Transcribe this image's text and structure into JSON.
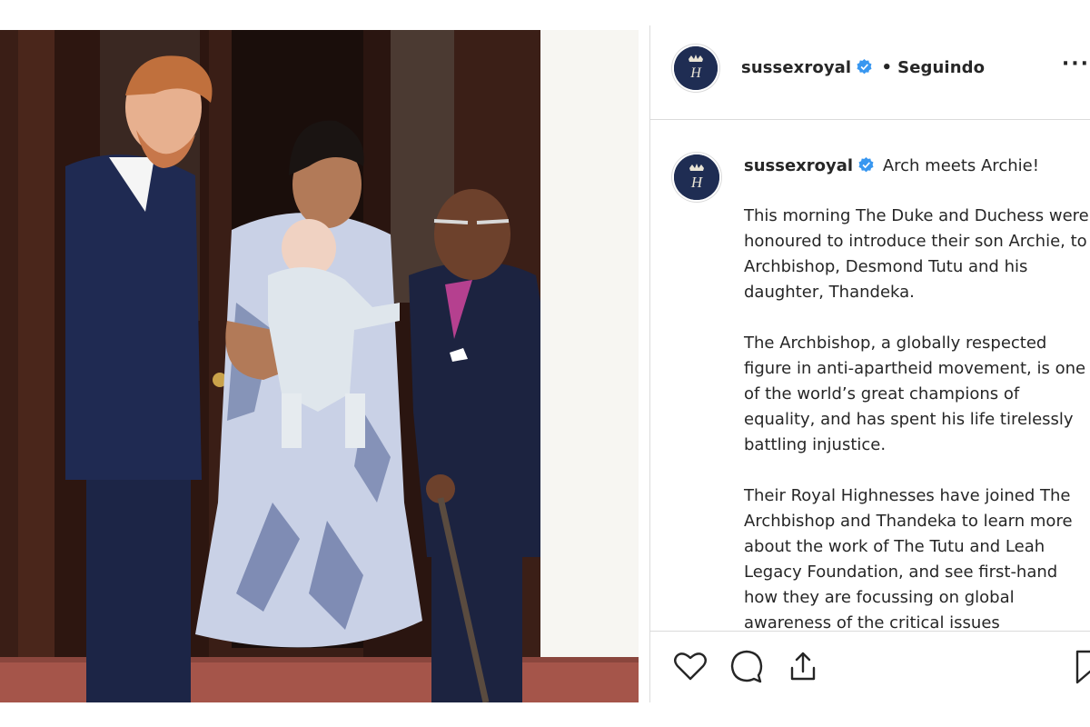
{
  "header": {
    "username": "sussexroyal",
    "separator": "•",
    "follow_status": "Seguindo",
    "more_label": "···",
    "avatar_monogram": "H"
  },
  "caption": {
    "username": "sussexroyal",
    "headline": "Arch meets Archie!",
    "paragraphs": [
      "This morning The Duke and Duchess were honoured to introduce their son Archie, to Archbishop, Desmond Tutu and his daughter, Thandeka.",
      "The Archbishop, a globally respected figure in anti-apartheid movement, is one of the world’s great champions of equality, and has spent his life tirelessly battling injustice.",
      "Their Royal Highnesses have joined The Archbishop and Thandeka to learn more about the work of The Tutu and Leah Legacy Foundation, and see first-hand how they are focussing on global awareness of the critical issues"
    ]
  },
  "actions": [
    "heart-icon",
    "comment-icon",
    "share-icon",
    "bookmark-icon"
  ],
  "colors": {
    "verified": "#3897f0",
    "avatar_bg": "#1f2d53",
    "border": "#dbdbdb",
    "text": "#262626"
  }
}
